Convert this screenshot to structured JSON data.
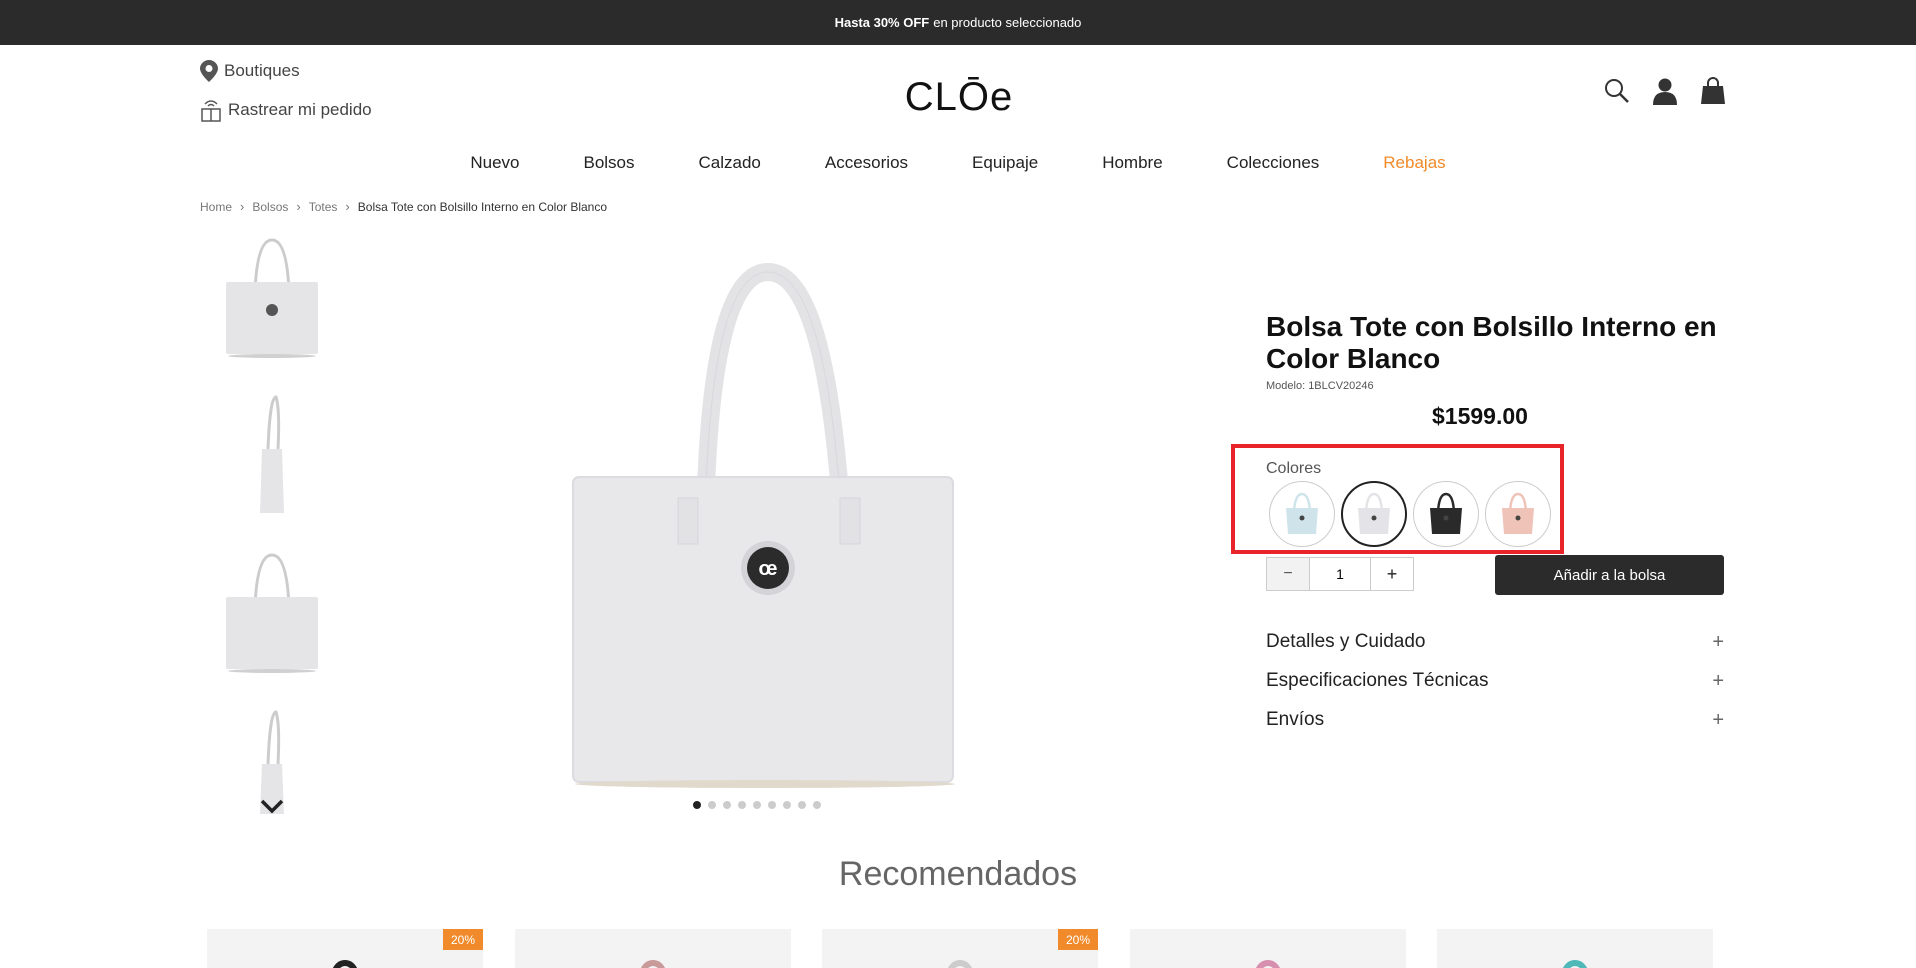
{
  "promo": {
    "bold": "Hasta 30% OFF",
    "text": "en producto seleccionado"
  },
  "header": {
    "boutiques": "Boutiques",
    "track_order": "Rastrear mi pedido",
    "logo_text": "CLŌe",
    "icons": [
      "search-icon",
      "user-icon",
      "shopping-bag-icon"
    ]
  },
  "nav": {
    "items": [
      "Nuevo",
      "Bolsos",
      "Calzado",
      "Accesorios",
      "Equipaje",
      "Hombre",
      "Colecciones",
      "Rebajas"
    ],
    "sale_color": "#f08a2a"
  },
  "breadcrumb": [
    "Home",
    "Bolsos",
    "Totes",
    "Bolsa Tote con Bolsillo Interno en Color Blanco"
  ],
  "product": {
    "title": "Bolsa Tote con Bolsillo Interno en Color Blanco",
    "model": "Modelo: 1BLCV20246",
    "price": "$1599.00",
    "colors_label": "Colores",
    "colors": [
      {
        "name": "light-blue",
        "hex": "#cfe4ea",
        "selected": false
      },
      {
        "name": "white",
        "hex": "#e4e4e8",
        "selected": true
      },
      {
        "name": "black",
        "hex": "#2a2a2a",
        "selected": false
      },
      {
        "name": "pink",
        "hex": "#efc3b8",
        "selected": false
      }
    ],
    "quantity": "1",
    "qty_minus": "−",
    "qty_plus": "+",
    "add_to_bag": "Añadir a la bolsa",
    "highlight_color": "#e8232a"
  },
  "gallery": {
    "dot_count": 9,
    "active_dot": 0
  },
  "accordion": [
    {
      "label": "Detalles y Cuidado",
      "icon": "+"
    },
    {
      "label": "Especificaciones Técnicas",
      "icon": "+"
    },
    {
      "label": "Envíos",
      "icon": "+"
    }
  ],
  "recommended": {
    "title": "Recomendados",
    "cards": [
      {
        "badge": "20%",
        "bag_color": "#222222"
      },
      {
        "badge": "",
        "bag_color": "#c99a9a"
      },
      {
        "badge": "20%",
        "bag_color": "#cccccc"
      },
      {
        "badge": "",
        "bag_color": "#d78fb0"
      },
      {
        "badge": "",
        "bag_color": "#4fb8b8"
      }
    ]
  }
}
